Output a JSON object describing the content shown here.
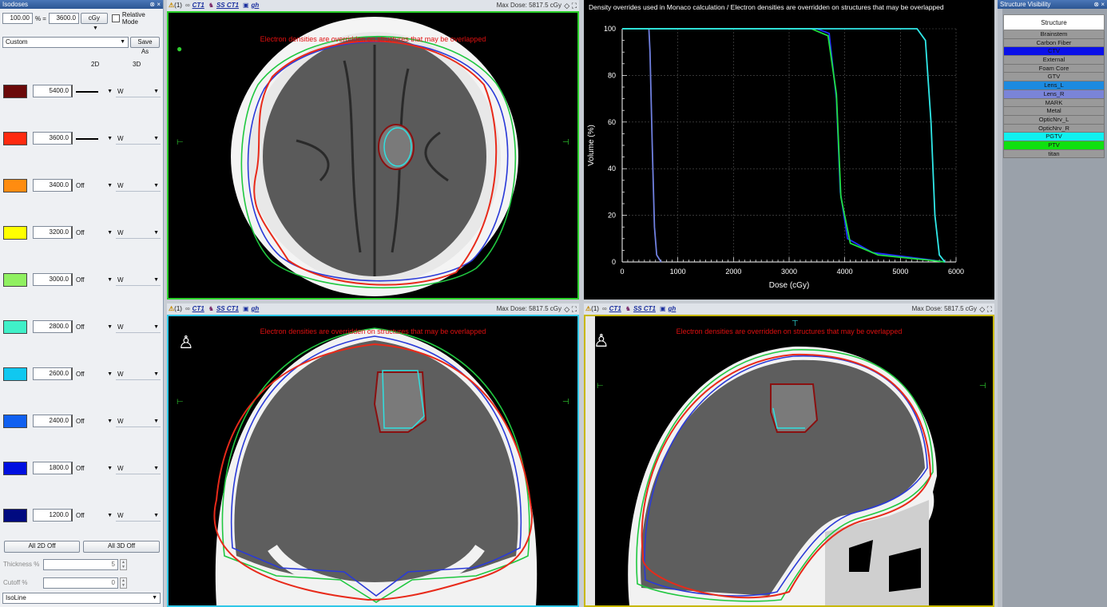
{
  "left_panel": {
    "title": "Isodoses",
    "pin": "⊗ ×",
    "percent_value": "100.00",
    "percent_sign": "% =",
    "ref_dose": "3600.0",
    "unit": "cGy",
    "relative_mode_label": "Relative Mode",
    "preset": "Custom",
    "save_as_label": "Save As",
    "col_2d": "2D",
    "col_3d": "3D",
    "isodoses": [
      {
        "value": "5400.0",
        "color": "#6b0a0a",
        "mode2d": "line",
        "mode3d": "W"
      },
      {
        "value": "3600.0",
        "color": "#ff2a10",
        "mode2d": "line",
        "mode3d": "W"
      },
      {
        "value": "3400.0",
        "color": "#ff8c10",
        "mode2d": "Off",
        "mode3d": "W"
      },
      {
        "value": "3200.0",
        "color": "#ffff00",
        "mode2d": "Off",
        "mode3d": "W"
      },
      {
        "value": "3000.0",
        "color": "#90f060",
        "mode2d": "Off",
        "mode3d": "W"
      },
      {
        "value": "2800.0",
        "color": "#40f0c8",
        "mode2d": "Off",
        "mode3d": "W"
      },
      {
        "value": "2600.0",
        "color": "#10c8f0",
        "mode2d": "Off",
        "mode3d": "W"
      },
      {
        "value": "2400.0",
        "color": "#1060f0",
        "mode2d": "Off",
        "mode3d": "W"
      },
      {
        "value": "1800.0",
        "color": "#0010e0",
        "mode2d": "Off",
        "mode3d": "W"
      },
      {
        "value": "1200.0",
        "color": "#000a80",
        "mode2d": "Off",
        "mode3d": "W"
      }
    ],
    "all_2d_off": "All 2D Off",
    "all_3d_off": "All 3D Off",
    "thickness_label": "Thickness %",
    "thickness_value": "5",
    "cutoff_label": "Cutoff %",
    "cutoff_value": "0",
    "display_mode": "IsoLine"
  },
  "viewport": {
    "warn_count": "(1)",
    "dataset": "CT1",
    "structure_set": "SS CT1",
    "plan": "gh",
    "max_dose": "Max Dose: 5817.5 cGy",
    "overlay_warning": "Electron densities are overridden on structures that may be overlapped"
  },
  "dvh": {
    "title": "Density overrides used in Monaco calculation / Electron densities are overridden on structures that may be overlapped",
    "chart_data": {
      "type": "line",
      "xlabel": "Dose (cGy)",
      "ylabel": "Volume (%)",
      "xlim": [
        0,
        6000
      ],
      "ylim": [
        0,
        100
      ],
      "xticks": [
        "0",
        "1000",
        "2000",
        "3000",
        "4000",
        "5000",
        "6000"
      ],
      "yticks": [
        "0",
        "20",
        "40",
        "60",
        "80",
        "100"
      ],
      "grid": true,
      "series": [
        {
          "color": "#7080e0",
          "x": [
            0,
            480,
            500,
            540,
            580,
            620,
            700
          ],
          "y": [
            100,
            100,
            90,
            50,
            15,
            3,
            0
          ]
        },
        {
          "color": "#2030ff",
          "x": [
            0,
            3500,
            3720,
            3850,
            3920,
            4050,
            4500,
            5500,
            5800
          ],
          "y": [
            100,
            100,
            98,
            70,
            30,
            10,
            4,
            1,
            0
          ]
        },
        {
          "color": "#20e040",
          "x": [
            0,
            3400,
            3700,
            3850,
            3930,
            4100,
            4600,
            5500,
            5800
          ],
          "y": [
            100,
            100,
            97,
            72,
            28,
            8,
            3,
            0.8,
            0
          ]
        },
        {
          "color": "#30e8e8",
          "x": [
            0,
            5300,
            5450,
            5550,
            5620,
            5700,
            5800
          ],
          "y": [
            100,
            100,
            95,
            60,
            20,
            3,
            0
          ]
        }
      ]
    }
  },
  "structure_panel": {
    "title": "Structure Visibility",
    "pin": "⊗ ×",
    "header": "Structure",
    "structures": [
      {
        "name": "Brainstem",
        "color": "#9a9a9a"
      },
      {
        "name": "Carbon Fiber",
        "color": "#9a9a9a"
      },
      {
        "name": "CTV",
        "color": "#0a10e8"
      },
      {
        "name": "External",
        "color": "#9a9a9a"
      },
      {
        "name": "Foam Core",
        "color": "#9a9a9a"
      },
      {
        "name": "GTV",
        "color": "#9a9a9a"
      },
      {
        "name": "Lens_L",
        "color": "#1c8ae0"
      },
      {
        "name": "Lens_R",
        "color": "#7a84d8"
      },
      {
        "name": "MARK",
        "color": "#9a9a9a"
      },
      {
        "name": "Metal",
        "color": "#9a9a9a"
      },
      {
        "name": "OpticNrv_L",
        "color": "#9a9a9a"
      },
      {
        "name": "OpticNrv_R",
        "color": "#9a9a9a"
      },
      {
        "name": "PGTV",
        "color": "#10f0f0"
      },
      {
        "name": "PTV",
        "color": "#10e010"
      },
      {
        "name": "titan",
        "color": "#9a9a9a"
      }
    ]
  }
}
